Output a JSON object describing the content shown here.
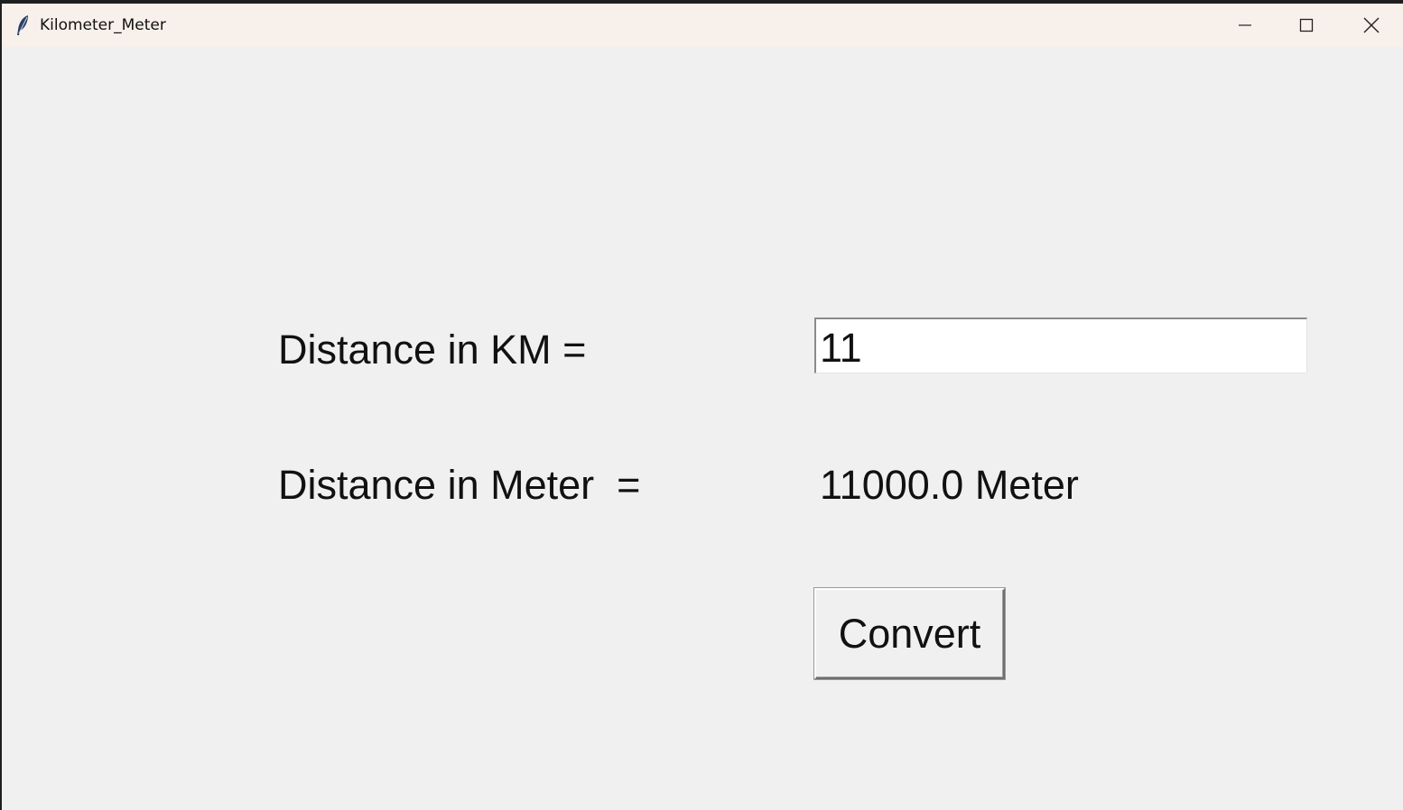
{
  "window": {
    "title": "Kilometer_Meter",
    "icon": "feather-icon",
    "controls": [
      "minimize-icon",
      "maximize-icon",
      "close-icon"
    ]
  },
  "form": {
    "km_label": "Distance in KM =",
    "km_value": "11",
    "meter_label": "Distance in Meter  =",
    "meter_result": "11000.0 Meter",
    "convert_label": "Convert"
  },
  "colors": {
    "background": "#f0f0f0",
    "titlebar": "#f8f0ea",
    "input_background": "#ffffff",
    "text": "#111111"
  }
}
